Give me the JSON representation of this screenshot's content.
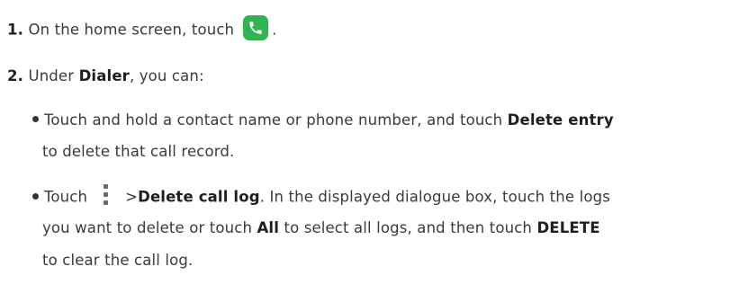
{
  "steps": [
    {
      "number": "1.",
      "text_before": "On the home screen, touch",
      "icon": "phone-app-icon",
      "text_after": "."
    },
    {
      "number": "2.",
      "text_before": "Under",
      "bold": "Dialer",
      "text_after": ", you can:"
    }
  ],
  "bullets": [
    {
      "line1_before": "Touch and hold a contact name or phone number, and touch",
      "line1_bold": "Delete entry",
      "line2": "to delete that call record."
    },
    {
      "line1_before": "Touch",
      "icon": "more-menu-icon",
      "line1_gt": ">",
      "line1_bold": "Delete call log",
      "line1_after": ". In the displayed dialogue box, touch the logs",
      "line2_before": "you want to delete or touch",
      "line2_bold1": "All",
      "line2_mid": "to select all logs, and then touch",
      "line2_bold2": "DELETE",
      "line3": "to clear the call log."
    }
  ],
  "colors": {
    "text": "#3a3a3a",
    "phone_icon_bg": "#2fb552"
  }
}
